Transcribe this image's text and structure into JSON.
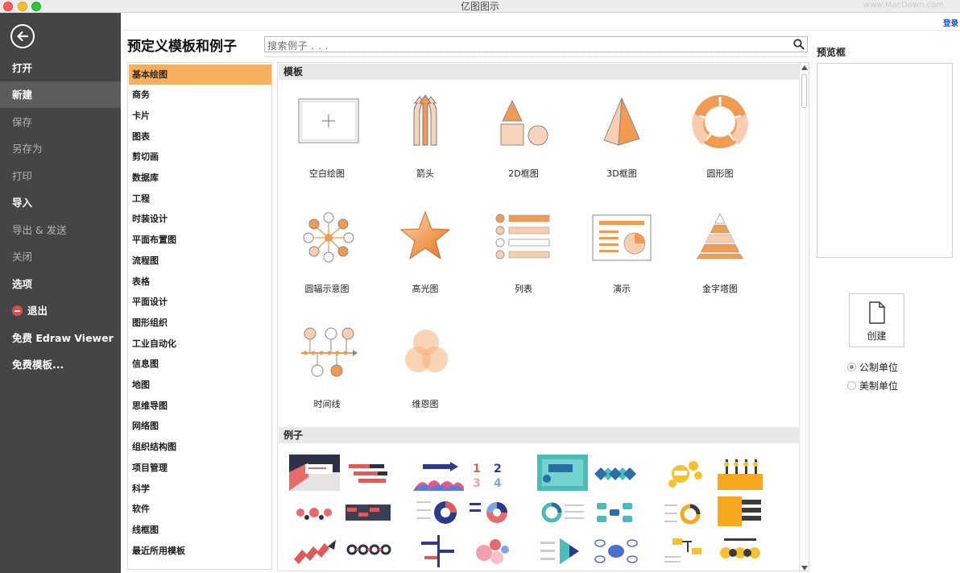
{
  "window": {
    "title": "亿图图示",
    "watermark": "www.MacDown.com"
  },
  "topbar": {
    "login_label": "登录"
  },
  "left_menu": {
    "items": [
      {
        "label": "打开"
      },
      {
        "label": "新建"
      },
      {
        "label": "保存"
      },
      {
        "label": "另存为"
      },
      {
        "label": "打印"
      },
      {
        "label": "导入"
      },
      {
        "label": "导出 & 发送"
      },
      {
        "label": "关闭"
      },
      {
        "label": "选项"
      },
      {
        "label": "退出"
      },
      {
        "label": "免费 Edraw Viewer"
      },
      {
        "label": "免费模板..."
      }
    ]
  },
  "page": {
    "title": "预定义模板和例子"
  },
  "search": {
    "placeholder": "搜索例子 . . ."
  },
  "categories": [
    "基本绘图",
    "商务",
    "卡片",
    "图表",
    "剪切画",
    "数据库",
    "工程",
    "时装设计",
    "平面布置图",
    "流程图",
    "表格",
    "平面设计",
    "图形组织",
    "工业自动化",
    "信息图",
    "地图",
    "思维导图",
    "网络图",
    "组织结构图",
    "项目管理",
    "科学",
    "软件",
    "线框图",
    "最近所用模板"
  ],
  "sections": {
    "templates": "模板",
    "examples": "例子"
  },
  "templates": [
    {
      "label": "空白绘图",
      "icon": "blank-drawing-icon"
    },
    {
      "label": "箭头",
      "icon": "arrows-icon"
    },
    {
      "label": "2D框图",
      "icon": "2d-block-icon"
    },
    {
      "label": "3D框图",
      "icon": "3d-block-icon"
    },
    {
      "label": "圆形图",
      "icon": "circular-icon"
    },
    {
      "label": "圆辐示意图",
      "icon": "radial-diagram-icon"
    },
    {
      "label": "高光图",
      "icon": "star-highlight-icon"
    },
    {
      "label": "列表",
      "icon": "list-icon"
    },
    {
      "label": "演示",
      "icon": "presentation-icon"
    },
    {
      "label": "金字塔图",
      "icon": "pyramid-icon"
    },
    {
      "label": "时间线",
      "icon": "timeline-icon"
    },
    {
      "label": "维恩图",
      "icon": "venn-icon"
    }
  ],
  "preview": {
    "label": "预览框",
    "create_label": "创建"
  },
  "units": {
    "metric": "公制单位",
    "imperial": "美制单位",
    "selected": "metric"
  },
  "colors": {
    "accent": "#f7ae5e",
    "orange": "#f09a52",
    "orange_light": "#f8cdb0",
    "menu_bg": "#454545"
  }
}
